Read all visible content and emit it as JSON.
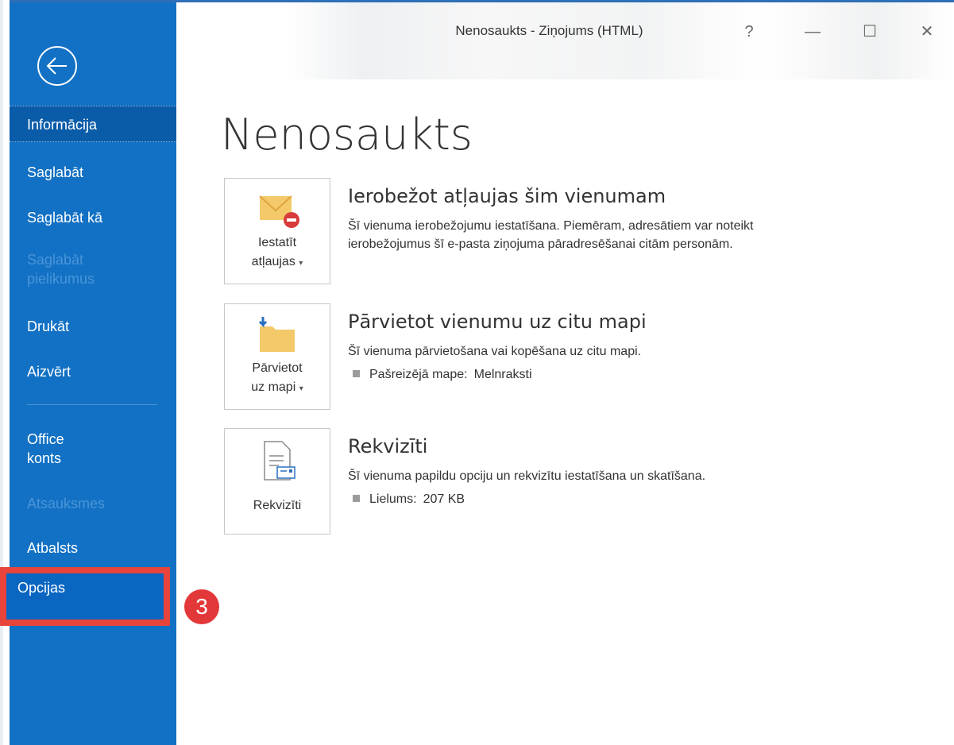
{
  "window": {
    "title": "Nenosaukts  -  Ziņojums (HTML)",
    "help": "?",
    "minimize": "—",
    "maximize": "☐",
    "close": "✕"
  },
  "sidebar": {
    "items": [
      {
        "label": "Informācija"
      },
      {
        "label": "Saglabāt"
      },
      {
        "label": "Saglabāt kā"
      },
      {
        "label": "Saglabāt pielikumus",
        "line1": "Saglabāt",
        "line2": "pielikumus"
      },
      {
        "label": "Drukāt"
      },
      {
        "label": "Aizvērt"
      },
      {
        "label": "Office konts",
        "line1": "Office",
        "line2": "konts"
      },
      {
        "label": "Atsauksmes"
      },
      {
        "label": "Atbalsts"
      },
      {
        "label": "Opcijas"
      }
    ],
    "annotation_badge": "3"
  },
  "main": {
    "page_title": "Nenosaukts",
    "sections": [
      {
        "button_line1": "Iestatīt",
        "button_line2": "atļaujas",
        "heading": "Ierobežot atļaujas šim vienumam",
        "desc_line1": "Šī vienuma ierobežojumu iestatīšana. Piemēram, adresātiem var noteikt",
        "desc_line2": "ierobežojumus šī e-pasta ziņojuma pāradresēšanai citām personām."
      },
      {
        "button_line1": "Pārvietot",
        "button_line2": "uz mapi",
        "heading": "Pārvietot vienumu uz citu mapi",
        "desc_line1": "Šī vienuma pārvietošana vai kopēšana uz citu mapi.",
        "bullet_label": "Pašreizējā mape:",
        "bullet_value": "Melnraksti"
      },
      {
        "button_line1": "Rekvizīti",
        "heading": "Rekvizīti",
        "desc_line1": "Šī vienuma papildu opciju un rekvizītu iestatīšana un skatīšana.",
        "bullet_label": "Lielums:",
        "bullet_value": "207 KB"
      }
    ]
  },
  "colors": {
    "sidebar": "#1271c4",
    "selected": "#0a5ba8",
    "highlight_border": "#e8443b",
    "badge": "#e3383a"
  }
}
